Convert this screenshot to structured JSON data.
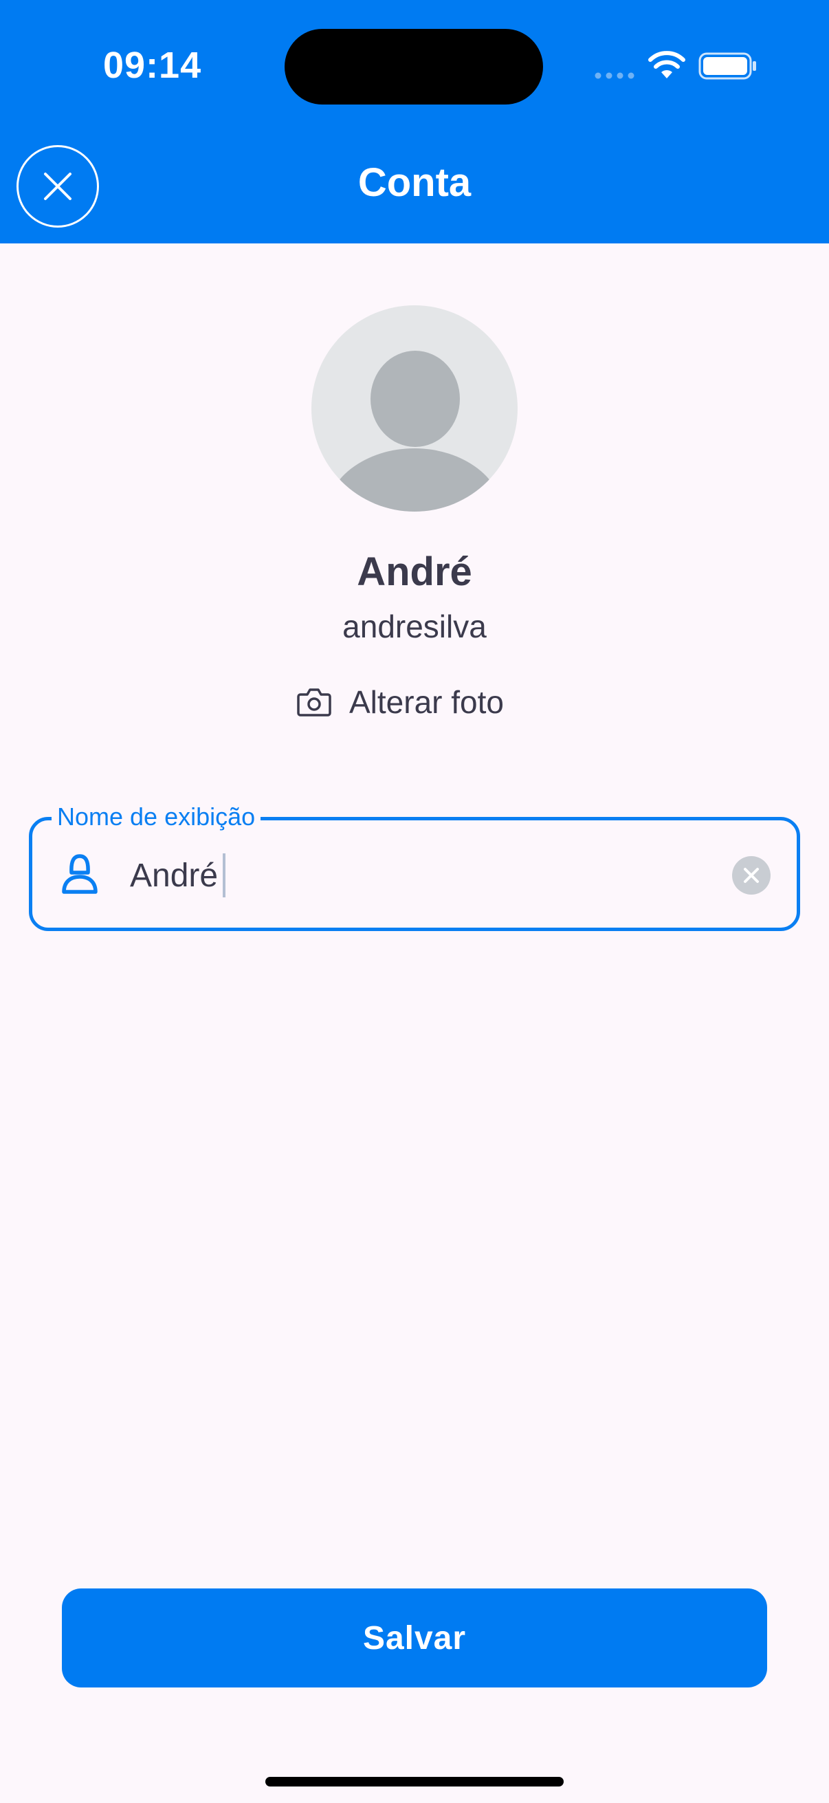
{
  "status_bar": {
    "time": "09:14",
    "icons": [
      "signal-icon",
      "wifi-icon",
      "battery-icon"
    ]
  },
  "header": {
    "title": "Conta",
    "close_icon": "close-icon"
  },
  "profile": {
    "avatar_icon": "avatar-placeholder-icon",
    "name": "André",
    "username": "andresilva",
    "change_photo_label": "Alterar foto",
    "change_photo_icon": "camera-icon"
  },
  "display_name_field": {
    "label": "Nome de exibição",
    "value": "André",
    "leading_icon": "user-icon",
    "trailing_icon": "clear-icon"
  },
  "actions": {
    "save_label": "Salvar"
  },
  "colors": {
    "primary": "#007bf2",
    "background": "#fdf7fc",
    "text": "#3b3a4c"
  }
}
